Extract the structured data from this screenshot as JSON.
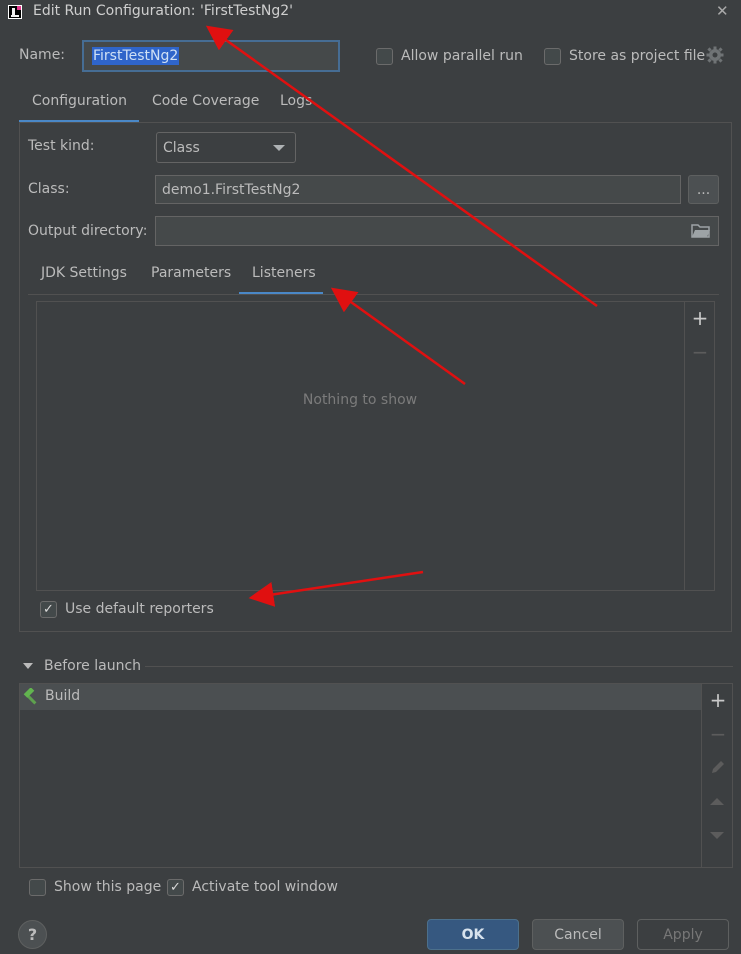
{
  "window": {
    "title": "Edit Run Configuration: 'FirstTestNg2'",
    "close_icon": "close-icon",
    "app_icon": "intellij-app-icon"
  },
  "header": {
    "name_label": "Name:",
    "name_value": "FirstTestNg2",
    "allow_parallel_label": "Allow parallel run",
    "allow_parallel_checked": false,
    "store_project_label": "Store as project file",
    "store_project_checked": false,
    "settings_icon": "gear-icon"
  },
  "main_tabs": [
    {
      "label": "Configuration",
      "active": true
    },
    {
      "label": "Code Coverage",
      "active": false
    },
    {
      "label": "Logs",
      "active": false
    }
  ],
  "config": {
    "test_kind_label": "Test kind:",
    "test_kind_value": "Class",
    "class_label": "Class:",
    "class_value": "demo1.FirstTestNg2",
    "browse_label": "...",
    "output_dir_label": "Output directory:",
    "output_dir_value": "",
    "folder_icon": "folder-icon"
  },
  "sub_tabs": [
    {
      "label": "JDK Settings",
      "active": false
    },
    {
      "label": "Parameters",
      "active": false
    },
    {
      "label": "Listeners",
      "active": true
    }
  ],
  "listeners": {
    "empty_text": "Nothing to show",
    "add_icon": "+",
    "remove_icon": "−",
    "use_default_reporters_label": "Use default reporters",
    "use_default_reporters_checked": true
  },
  "before_launch": {
    "section_label": "Before launch",
    "items": [
      {
        "label": "Build",
        "icon": "hammer-icon"
      }
    ],
    "tools": [
      "+",
      "−",
      "edit-icon",
      "move-up-icon",
      "move-down-icon"
    ]
  },
  "footer": {
    "show_page_label": "Show this page",
    "show_page_checked": false,
    "activate_tool_label": "Activate tool window",
    "activate_tool_checked": true,
    "help_label": "?",
    "ok_label": "OK",
    "cancel_label": "Cancel",
    "apply_label": "Apply"
  },
  "colors": {
    "background": "#3c3f41",
    "accent": "#4a88c7",
    "ok_button": "#365880",
    "annotation_arrows": "#e01010"
  }
}
